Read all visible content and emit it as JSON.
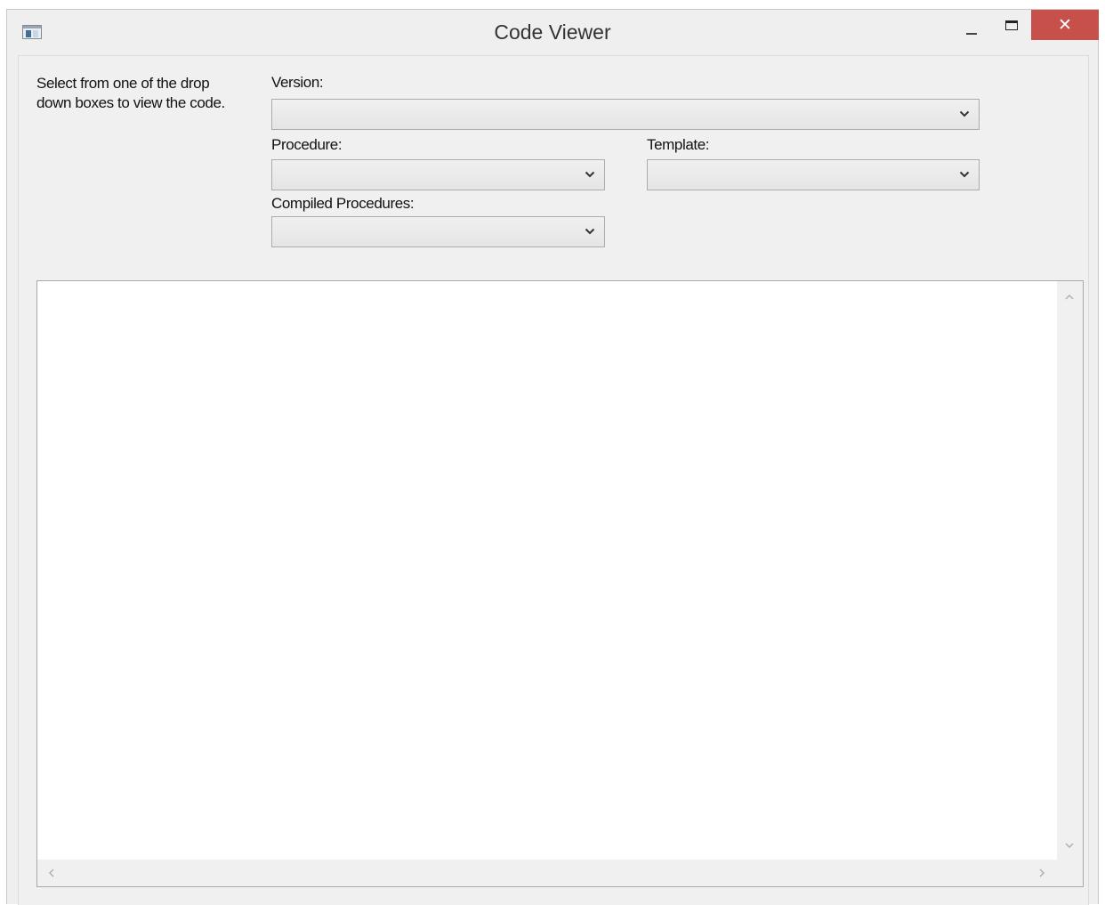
{
  "window": {
    "title": "Code Viewer",
    "icon": "application-window-icon",
    "controls": {
      "minimize": "minimize-icon",
      "maximize": "maximize-icon",
      "close_glyph": "✕",
      "close_color": "#c7504b"
    }
  },
  "form": {
    "instructions": "Select from one of the drop down boxes to view the code.",
    "instructions_line1": "Select from one of the drop",
    "instructions_line2": "down boxes to view the code.",
    "version_label": "Version:",
    "version_value": "",
    "procedure_label": "Procedure:",
    "procedure_value": "",
    "template_label": "Template:",
    "template_value": "",
    "compiled_label": "Compiled Procedures:",
    "compiled_value": ""
  },
  "code_view": {
    "content": ""
  }
}
